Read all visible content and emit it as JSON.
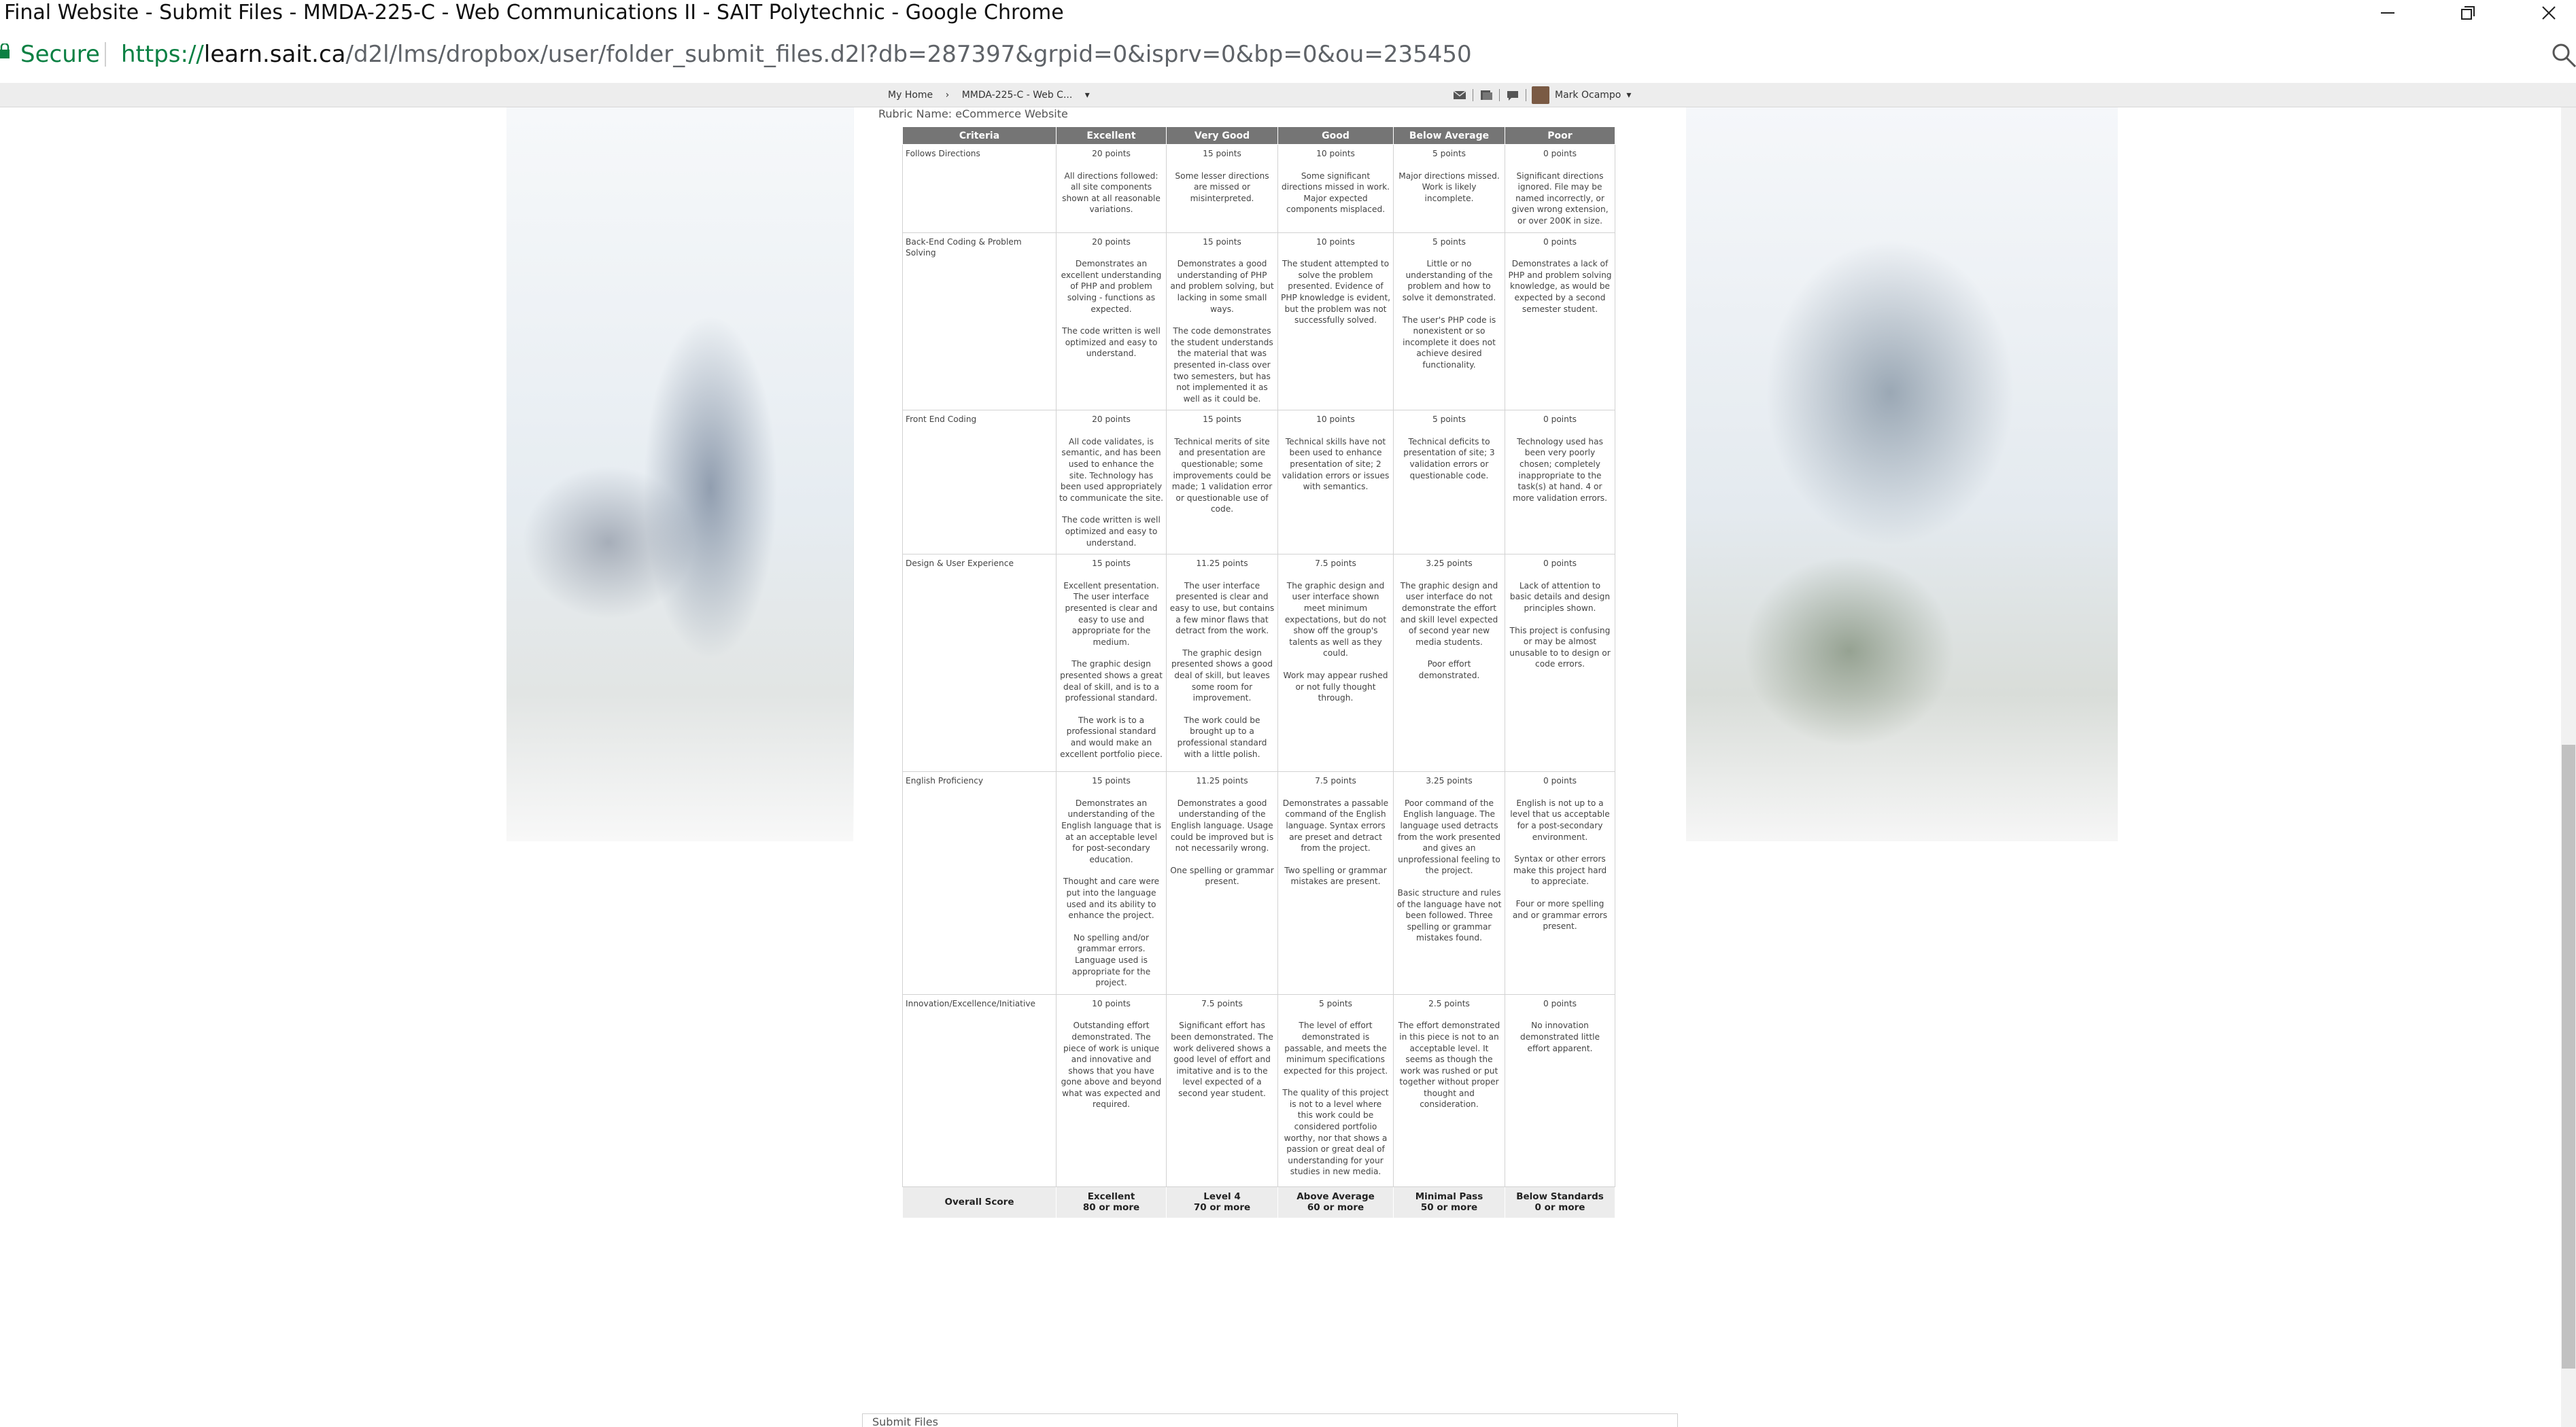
{
  "window": {
    "title": "Final Website - Submit Files - MMDA-225-C - Web Communications II - SAIT Polytechnic - Google Chrome"
  },
  "address_bar": {
    "security_label": "Secure",
    "url_proto": "https://",
    "url_host": "learn.sait.ca",
    "url_path": "/d2l/lms/dropbox/user/folder_submit_files.d2l?db=287397&grpid=0&isprv=0&bp=0&ou=235450"
  },
  "nav": {
    "home": "My Home",
    "course": "MMDA-225-C - Web C...",
    "user_name": "Mark Ocampo"
  },
  "rubric": {
    "name_label": "Rubric Name: eCommerce Website",
    "headers": [
      "Criteria",
      "Excellent",
      "Very Good",
      "Good",
      "Below Average",
      "Poor"
    ],
    "rows": [
      {
        "criterion": "Follows Directions",
        "cells": [
          {
            "points": "20 points",
            "text": [
              "All directions followed: all site components shown at all reasonable variations."
            ]
          },
          {
            "points": "15 points",
            "text": [
              "Some lesser directions are missed or misinterpreted."
            ]
          },
          {
            "points": "10 points",
            "text": [
              "Some significant directions missed in work. Major expected components misplaced."
            ]
          },
          {
            "points": "5 points",
            "text": [
              "Major directions missed. Work is likely incomplete."
            ]
          },
          {
            "points": "0 points",
            "text": [
              "Significant directions ignored. File may be named incorrectly, or given wrong extension, or over 200K in size."
            ]
          }
        ]
      },
      {
        "criterion": "Back-End Coding & Problem Solving",
        "cells": [
          {
            "points": "20 points",
            "text": [
              "Demonstrates an excellent understanding of PHP and problem solving - functions as expected.",
              "The code written is well optimized and easy to understand."
            ]
          },
          {
            "points": "15 points",
            "text": [
              "Demonstrates a good understanding of PHP and problem solving, but lacking in some small ways.",
              "The code demonstrates the student understands the material that was presented in-class over two semesters, but has not implemented it as well as it could be."
            ]
          },
          {
            "points": "10 points",
            "text": [
              "The student attempted to solve the problem presented. Evidence of PHP knowledge is evident, but the problem was not successfully solved."
            ]
          },
          {
            "points": "5 points",
            "text": [
              "Little or no understanding of the problem and how to solve it demonstrated.",
              "The user's PHP code is nonexistent or so incomplete it does not achieve desired functionality."
            ]
          },
          {
            "points": "0 points",
            "text": [
              "Demonstrates a lack of PHP and problem solving knowledge, as would be expected by a second semester student."
            ]
          }
        ]
      },
      {
        "criterion": "Front End Coding",
        "cells": [
          {
            "points": "20 points",
            "text": [
              "All code validates, is semantic, and has been used to enhance the site. Technology has been used appropriately to communicate the site.",
              "The code written is well optimized and easy to understand."
            ]
          },
          {
            "points": "15 points",
            "text": [
              "Technical merits of site and presentation are questionable; some improvements could be made; 1 validation error or questionable use of code."
            ]
          },
          {
            "points": "10 points",
            "text": [
              "Technical skills have not been used to enhance presentation of site; 2 validation errors or issues with semantics."
            ]
          },
          {
            "points": "5 points",
            "text": [
              "Technical deficits to presentation of site; 3 validation errors or questionable code."
            ]
          },
          {
            "points": "0 points",
            "text": [
              "Technology used has been very poorly chosen; completely inappropriate to the task(s) at hand. 4 or more validation errors."
            ]
          }
        ]
      },
      {
        "criterion": "Design & User Experience",
        "cells": [
          {
            "points": "15 points",
            "text": [
              "Excellent presentation. The user interface presented is clear and easy to use and appropriate for the medium.",
              "The graphic design presented shows a great deal of skill, and is to a professional standard.",
              "The work is to a professional standard and would make an excellent portfolio piece."
            ]
          },
          {
            "points": "11.25 points",
            "text": [
              "The user interface presented is clear and easy to use, but contains a few minor flaws that detract from the work.",
              "The graphic design presented shows a good deal of skill, but leaves some room for improvement.",
              "The work could be brought up to a professional standard with a little polish."
            ]
          },
          {
            "points": "7.5 points",
            "text": [
              "The graphic design and user interface shown meet minimum expectations, but do not show off the group's talents as well as they could.",
              "Work may appear rushed or not fully thought through."
            ]
          },
          {
            "points": "3.25 points",
            "text": [
              "The graphic design and user interface do not demonstrate the effort and skill level expected of second year new media students.",
              "Poor effort demonstrated."
            ]
          },
          {
            "points": "0 points",
            "text": [
              "Lack of attention to basic details and design principles shown.",
              "This project is confusing or may be almost unusable to to design or code errors."
            ]
          }
        ]
      },
      {
        "criterion": "English Proficiency",
        "cells": [
          {
            "points": "15 points",
            "text": [
              "Demonstrates an understanding of the English language that is at an acceptable level for post-secondary education.",
              "Thought and care were put into the language used and its ability to enhance the project.",
              "No spelling and/or grammar errors. Language used is appropriate for the project."
            ]
          },
          {
            "points": "11.25 points",
            "text": [
              "Demonstrates a good understanding of the English language. Usage could be improved but is not necessarily wrong.",
              "One spelling or grammar present."
            ]
          },
          {
            "points": "7.5 points",
            "text": [
              "Demonstrates a passable command of the English language. Syntax errors are preset and detract from the project.",
              "Two spelling or grammar mistakes are present."
            ]
          },
          {
            "points": "3.25 points",
            "text": [
              "Poor command of the English language. The language used detracts from the work presented and gives an unprofessional feeling to the project.",
              "Basic structure and rules of the language have not been followed. Three spelling or grammar mistakes found."
            ]
          },
          {
            "points": "0 points",
            "text": [
              "English is not up to a level that us acceptable for a post-secondary environment.",
              "Syntax or other errors make this project hard to appreciate.",
              "Four or more spelling and or grammar errors present."
            ]
          }
        ]
      },
      {
        "criterion": "Innovation/Excellence/Initiative",
        "cells": [
          {
            "points": "10 points",
            "text": [
              "Outstanding effort demonstrated. The piece of work is unique and innovative and shows that you have gone above and beyond what was expected and required."
            ]
          },
          {
            "points": "7.5 points",
            "text": [
              "Significant effort has been demonstrated. The work delivered shows a good level of effort and imitative and is to the level expected of a second year student."
            ]
          },
          {
            "points": "5 points",
            "text": [
              "The level of effort demonstrated is passable, and meets the minimum specifications expected for this project.",
              "The quality of this project is not to a level where this work could be considered portfolio worthy, nor that shows a passion or great deal of understanding for your studies in new media."
            ]
          },
          {
            "points": "2.5 points",
            "text": [
              "The effort demonstrated in this piece is not to an acceptable level. It seems as though the work was rushed or put together without proper thought and consideration."
            ]
          },
          {
            "points": "0 points",
            "text": [
              "No innovation demonstrated little effort apparent."
            ]
          }
        ]
      }
    ],
    "overall": {
      "label": "Overall Score",
      "levels": [
        {
          "name": "Excellent",
          "threshold": "80 or more"
        },
        {
          "name": "Level 4",
          "threshold": "70 or more"
        },
        {
          "name": "Above Average",
          "threshold": "60 or more"
        },
        {
          "name": "Minimal Pass",
          "threshold": "50 or more"
        },
        {
          "name": "Below Standards",
          "threshold": "0 or more"
        }
      ]
    }
  },
  "submit_section": {
    "label": "Submit Files"
  },
  "colors": {
    "secure_green": "#0b8043",
    "header_gray": "#757575",
    "overall_bg": "#ececec"
  },
  "icons": [
    "lock-icon",
    "minimize-icon",
    "maximize-icon",
    "close-icon",
    "zoom-icon",
    "chevron-right-icon",
    "chevron-down-icon",
    "message-icon",
    "subscription-icon",
    "update-icon",
    "avatar"
  ]
}
